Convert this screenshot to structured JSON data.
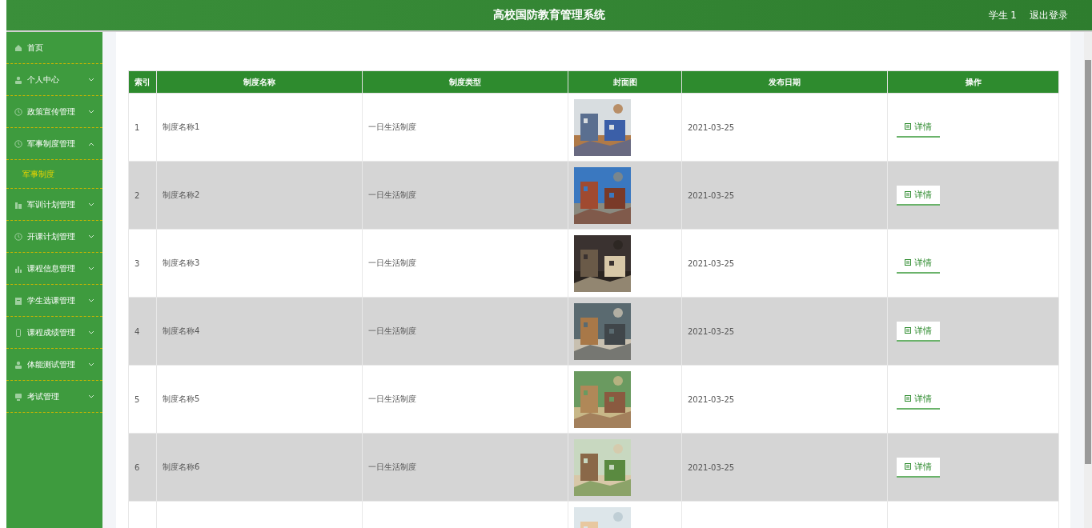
{
  "header": {
    "title": "高校国防教育管理系统",
    "user": "学生 1",
    "logout": "退出登录"
  },
  "sidebar": {
    "items": [
      {
        "label": "首页",
        "kind": "link"
      },
      {
        "label": "个人中心",
        "kind": "menu",
        "expanded": false
      },
      {
        "label": "政策宣传管理",
        "kind": "menu",
        "expanded": false
      },
      {
        "label": "军事制度管理",
        "kind": "menu",
        "expanded": true,
        "children": [
          {
            "label": "军事制度",
            "selected": true
          }
        ]
      },
      {
        "label": "军训计划管理",
        "kind": "menu",
        "expanded": false
      },
      {
        "label": "开课计划管理",
        "kind": "menu",
        "expanded": false
      },
      {
        "label": "课程信息管理",
        "kind": "menu",
        "expanded": false
      },
      {
        "label": "学生选课管理",
        "kind": "menu",
        "expanded": false
      },
      {
        "label": "课程成绩管理",
        "kind": "menu",
        "expanded": false
      },
      {
        "label": "体能测试管理",
        "kind": "menu",
        "expanded": false
      },
      {
        "label": "考试管理",
        "kind": "menu",
        "expanded": false
      }
    ]
  },
  "table": {
    "columns": [
      "索引",
      "制度名称",
      "制度类型",
      "封面图",
      "发布日期",
      "操作"
    ],
    "rows": [
      {
        "index": "1",
        "name": "制度名称1",
        "type": "一日生活制度",
        "date": "2021-03-25",
        "action": "详情"
      },
      {
        "index": "2",
        "name": "制度名称2",
        "type": "一日生活制度",
        "date": "2021-03-25",
        "action": "详情"
      },
      {
        "index": "3",
        "name": "制度名称3",
        "type": "一日生活制度",
        "date": "2021-03-25",
        "action": "详情"
      },
      {
        "index": "4",
        "name": "制度名称4",
        "type": "一日生活制度",
        "date": "2021-03-25",
        "action": "详情"
      },
      {
        "index": "5",
        "name": "制度名称5",
        "type": "一日生活制度",
        "date": "2021-03-25",
        "action": "详情"
      },
      {
        "index": "6",
        "name": "制度名称6",
        "type": "一日生活制度",
        "date": "2021-03-25",
        "action": "详情"
      },
      {
        "kind": "picture"
      }
    ]
  }
}
